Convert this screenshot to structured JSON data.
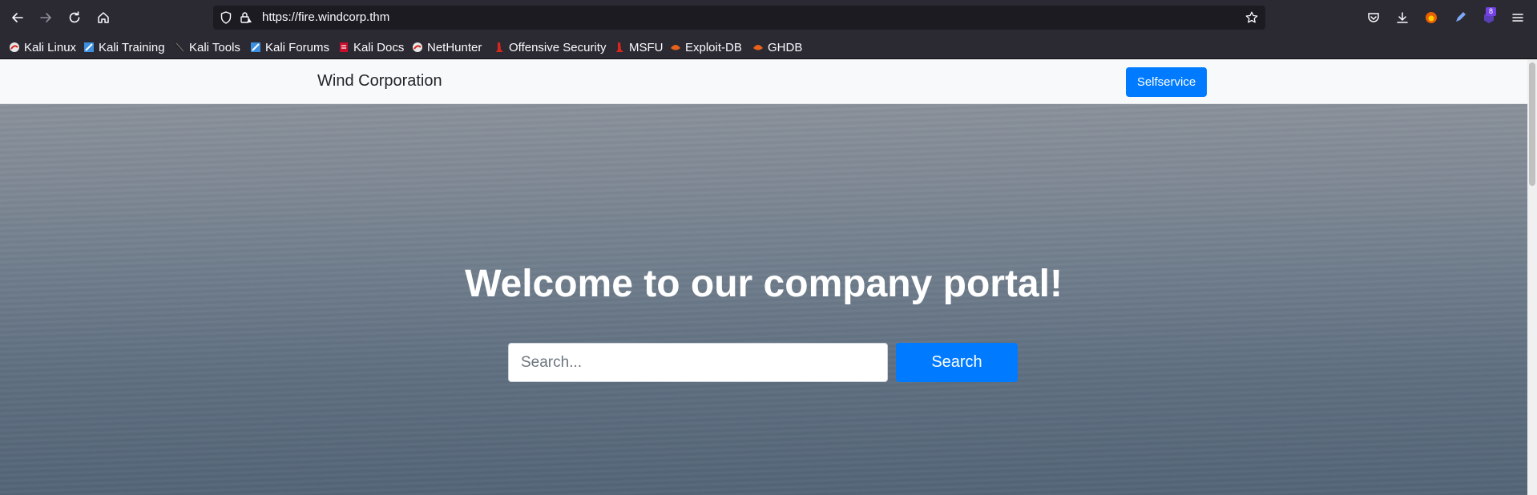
{
  "browser": {
    "url": "https://fire.windcorp.thm",
    "notification_count": "8"
  },
  "bookmarks": [
    {
      "label": "Kali Linux",
      "icon": "kali-dragon-icon"
    },
    {
      "label": "Kali Training",
      "icon": "kali-training-icon"
    },
    {
      "label": "Kali Tools",
      "icon": "kali-tools-icon"
    },
    {
      "label": "Kali Forums",
      "icon": "kali-forums-icon"
    },
    {
      "label": "Kali Docs",
      "icon": "kali-docs-icon"
    },
    {
      "label": "NetHunter",
      "icon": "nethunter-icon"
    },
    {
      "label": "Offensive Security",
      "icon": "offsec-icon"
    },
    {
      "label": "MSFU",
      "icon": "msfu-icon"
    },
    {
      "label": "Exploit-DB",
      "icon": "exploit-db-icon"
    },
    {
      "label": "GHDB",
      "icon": "ghdb-icon"
    }
  ],
  "page": {
    "brand": "Wind Corporation",
    "selfservice_label": "Selfservice",
    "hero_title": "Welcome to our company portal!",
    "search_placeholder": "Search...",
    "search_label": "Search"
  },
  "colors": {
    "accent": "#007bff",
    "navbar_bg": "#f8f9fa",
    "browser_chrome": "#2b2a33"
  }
}
